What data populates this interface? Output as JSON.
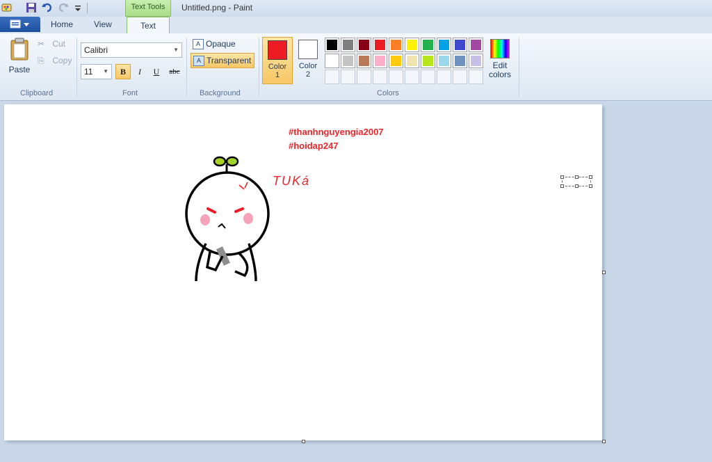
{
  "window": {
    "title": "Untitled.png - Paint",
    "context_tab": "Text Tools"
  },
  "tabs": {
    "home": "Home",
    "view": "View",
    "text": "Text"
  },
  "clipboard": {
    "paste": "Paste",
    "cut": "Cut",
    "copy": "Copy",
    "group": "Clipboard"
  },
  "font": {
    "family": "Calibri",
    "size": "11",
    "bold": "B",
    "italic": "I",
    "underline": "U",
    "strike": "abc",
    "group": "Font"
  },
  "background": {
    "opaque": "Opaque",
    "transparent": "Transparent",
    "group": "Background",
    "selected": "transparent"
  },
  "colors": {
    "color1_label": "Color",
    "color1_num": "1",
    "color1_value": "#ed1c24",
    "color2_label": "Color",
    "color2_num": "2",
    "color2_value": "#ffffff",
    "edit_label1": "Edit",
    "edit_label2": "colors",
    "group": "Colors",
    "row1": [
      "#000000",
      "#7f7f7f",
      "#880015",
      "#ed1c24",
      "#ff7f27",
      "#fff200",
      "#22b14c",
      "#00a2e8",
      "#3f48cc",
      "#a349a4"
    ],
    "row2": [
      "#ffffff",
      "#c3c3c3",
      "#b97a57",
      "#ffaec9",
      "#ffc90e",
      "#efe4b0",
      "#b5e61d",
      "#99d9ea",
      "#7092be",
      "#c8bfe7"
    ],
    "row3": [
      "",
      "",
      "",
      "",
      "",
      "",
      "",
      "",
      "",
      ""
    ]
  },
  "canvas": {
    "hashtag1": "#thanhnguyengia2007",
    "hashtag2": "#hoidap247",
    "handwriting": "TUKá",
    "text_color": "#e8262b"
  }
}
